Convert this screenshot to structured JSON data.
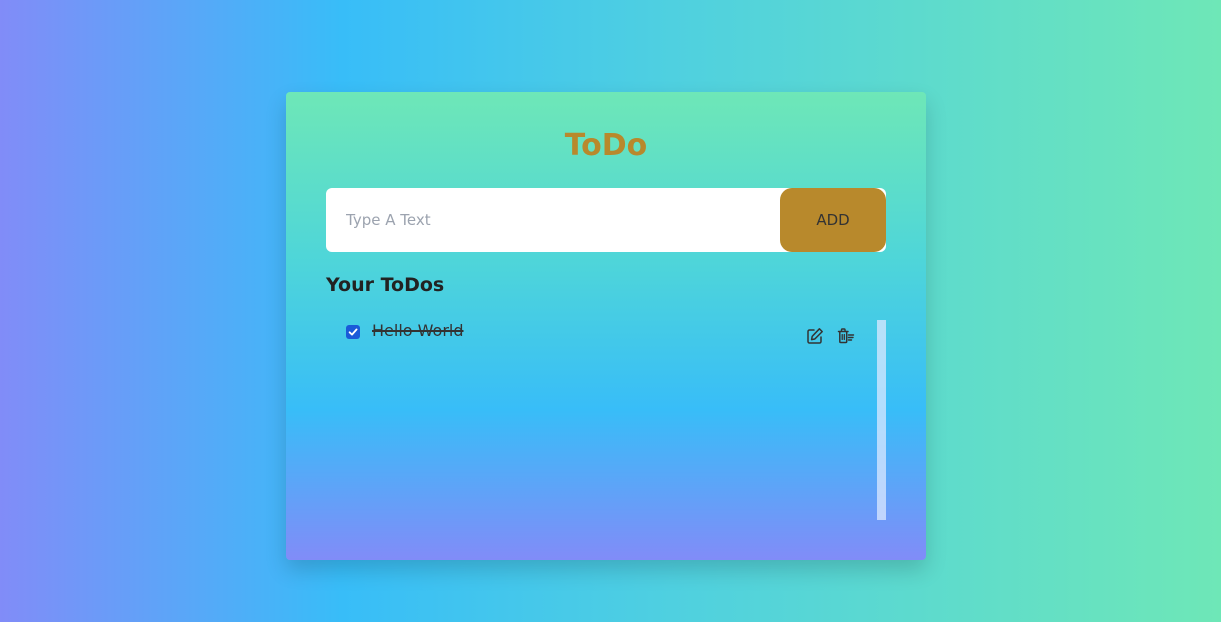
{
  "app": {
    "title": "ToDo"
  },
  "input": {
    "placeholder": "Type A Text",
    "value": ""
  },
  "add_button": {
    "label": "ADD"
  },
  "list": {
    "heading": "Your ToDos",
    "items": [
      {
        "text": "Hello World",
        "completed": true,
        "actions": [
          "edit-icon",
          "delete-icon"
        ]
      }
    ]
  },
  "colors": {
    "accent": "#b8892c",
    "checkbox": "#1a5ad8",
    "card_top": "#6ee7b7",
    "card_middle": "#38bdf8",
    "card_bottom": "#818cf8"
  }
}
